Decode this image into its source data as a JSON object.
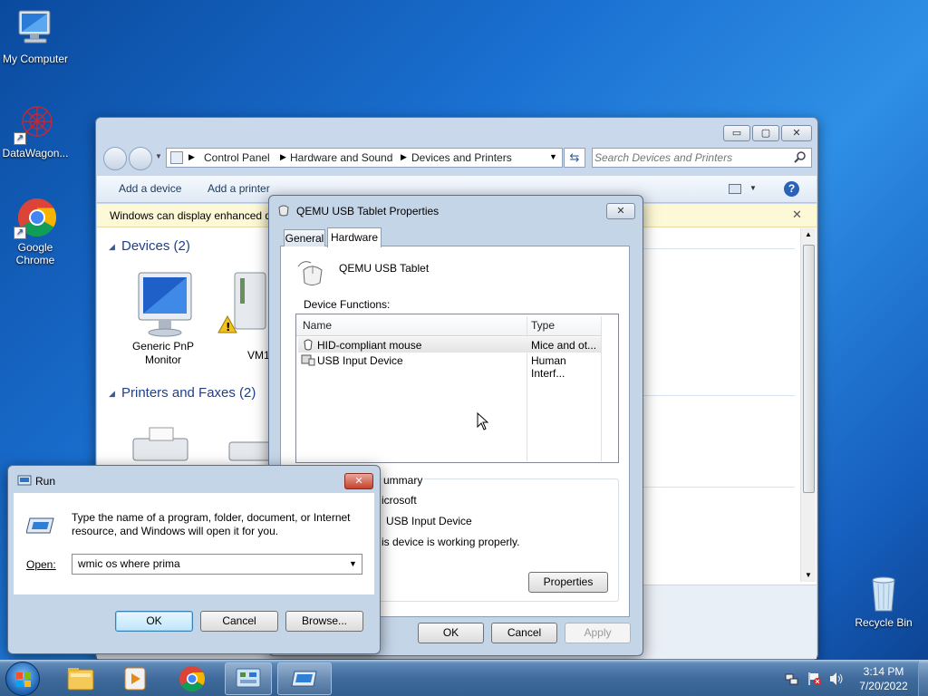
{
  "desktop": {
    "icons": [
      {
        "label": "My Computer"
      },
      {
        "label": "DataWagon..."
      },
      {
        "label": "Google Chrome"
      },
      {
        "label": "Recycle Bin"
      }
    ]
  },
  "explorer": {
    "breadcrumb": [
      "Control Panel",
      "Hardware and Sound",
      "Devices and Printers"
    ],
    "search_placeholder": "Search Devices and Printers",
    "commands": {
      "add_device": "Add a device",
      "add_printer": "Add a printer"
    },
    "infobar": "Windows can display enhanced d",
    "groups": {
      "devices": "Devices (2)",
      "printers": "Printers and Faxes (2)"
    },
    "devices": [
      {
        "label": "Generic PnP Monitor"
      },
      {
        "label": "VM1"
      }
    ],
    "controls": {
      "minimize": "▭",
      "maximize": "▢",
      "close": "✕"
    }
  },
  "props_dialog": {
    "title": "QEMU USB Tablet Properties",
    "tabs": [
      "General",
      "Hardware"
    ],
    "device_name": "QEMU USB Tablet",
    "functions_label": "Device Functions:",
    "columns": [
      "Name",
      "Type"
    ],
    "rows": [
      {
        "name": "HID-compliant mouse",
        "type": "Mice and ot..."
      },
      {
        "name": "USB Input Device",
        "type": "Human Interf..."
      }
    ],
    "summary": {
      "group_label": "ummary",
      "manufacturer": "icrosoft",
      "location": "USB Input Device",
      "status": "is device is working properly."
    },
    "properties_button": "Properties",
    "ok": "OK",
    "cancel": "Cancel",
    "apply": "Apply"
  },
  "run_dialog": {
    "title": "Run",
    "description": "Type the name of a program, folder, document, or Internet resource, and Windows will open it for you.",
    "open_label": "Open:",
    "input_value": "wmic os where prima",
    "ok": "OK",
    "cancel": "Cancel",
    "browse": "Browse..."
  },
  "taskbar": {
    "time": "3:14 PM",
    "date": "7/20/2022"
  }
}
